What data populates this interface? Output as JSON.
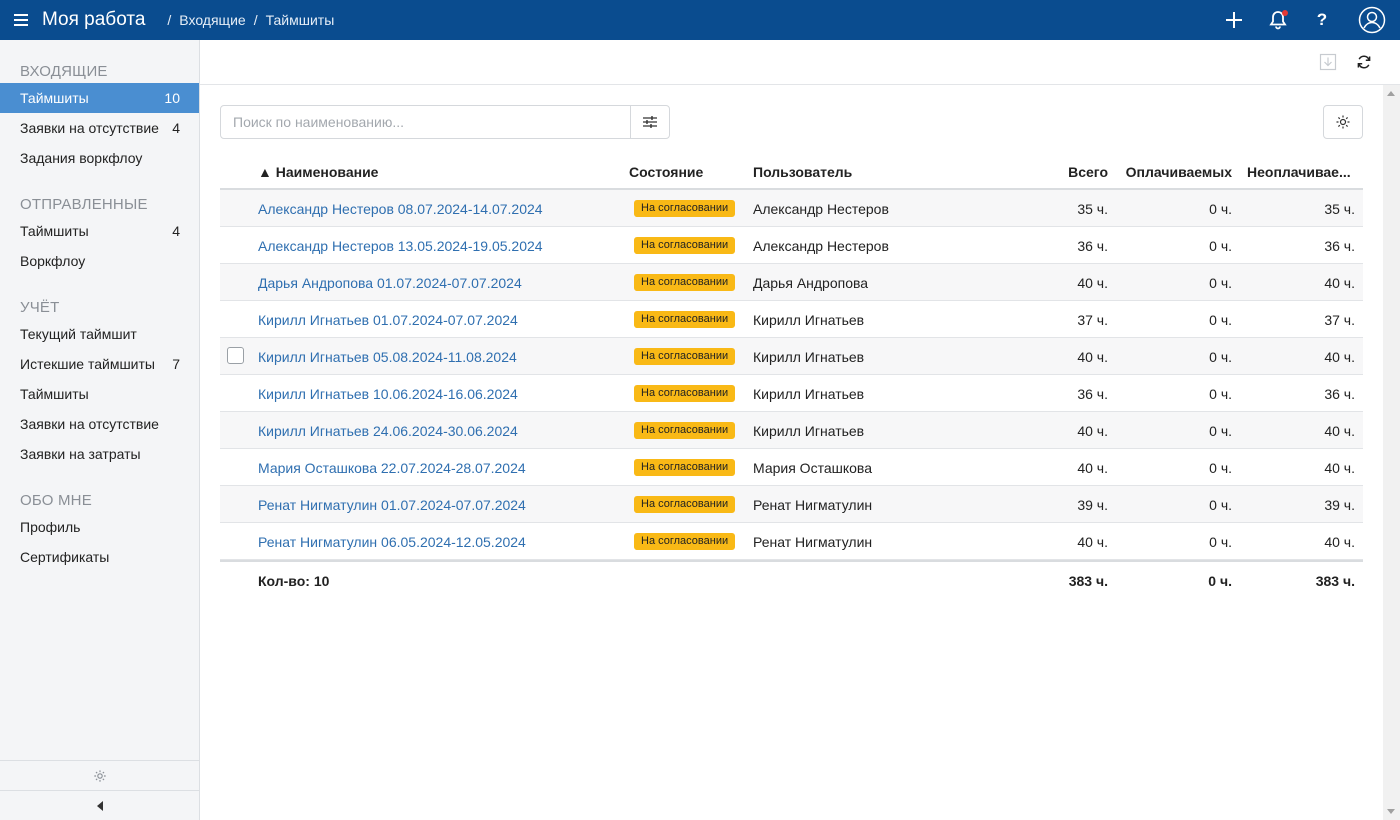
{
  "header": {
    "title": "Моя работа",
    "breadcrumbs": [
      "Входящие",
      "Таймшиты"
    ]
  },
  "sidebar": {
    "sections": [
      {
        "title": "ВХОДЯЩИЕ",
        "items": [
          {
            "label": "Таймшиты",
            "count": "10",
            "active": true
          },
          {
            "label": "Заявки на отсутствие",
            "count": "4"
          },
          {
            "label": "Задания воркфлоу",
            "count": ""
          }
        ]
      },
      {
        "title": "ОТПРАВЛЕННЫЕ",
        "items": [
          {
            "label": "Таймшиты",
            "count": "4"
          },
          {
            "label": "Воркфлоу",
            "count": ""
          }
        ]
      },
      {
        "title": "УЧЁТ",
        "items": [
          {
            "label": "Текущий таймшит",
            "count": ""
          },
          {
            "label": "Истекшие таймшиты",
            "count": "7"
          },
          {
            "label": "Таймшиты",
            "count": ""
          },
          {
            "label": "Заявки на отсутствие",
            "count": ""
          },
          {
            "label": "Заявки на затраты",
            "count": ""
          }
        ]
      },
      {
        "title": "ОБО МНЕ",
        "items": [
          {
            "label": "Профиль",
            "count": ""
          },
          {
            "label": "Сертификаты",
            "count": ""
          }
        ]
      }
    ]
  },
  "search": {
    "placeholder": "Поиск по наименованию..."
  },
  "table": {
    "sort_indicator": "▲",
    "columns": {
      "name": "Наименование",
      "state": "Состояние",
      "user": "Пользователь",
      "total": "Всего",
      "billable": "Оплачиваемых",
      "nonbillable": "Неоплачивае..."
    },
    "rows": [
      {
        "name": "Александр Нестеров 08.07.2024-14.07.2024",
        "state": "На согласовании",
        "user": "Александр Нестеров",
        "total": "35 ч.",
        "billable": "0 ч.",
        "nonbillable": "35 ч."
      },
      {
        "name": "Александр Нестеров 13.05.2024-19.05.2024",
        "state": "На согласовании",
        "user": "Александр Нестеров",
        "total": "36 ч.",
        "billable": "0 ч.",
        "nonbillable": "36 ч."
      },
      {
        "name": "Дарья Андропова 01.07.2024-07.07.2024",
        "state": "На согласовании",
        "user": "Дарья Андропова",
        "total": "40 ч.",
        "billable": "0 ч.",
        "nonbillable": "40 ч."
      },
      {
        "name": "Кирилл Игнатьев 01.07.2024-07.07.2024",
        "state": "На согласовании",
        "user": "Кирилл Игнатьев",
        "total": "37 ч.",
        "billable": "0 ч.",
        "nonbillable": "37 ч."
      },
      {
        "name": "Кирилл Игнатьев 05.08.2024-11.08.2024",
        "state": "На согласовании",
        "user": "Кирилл Игнатьев",
        "total": "40 ч.",
        "billable": "0 ч.",
        "nonbillable": "40 ч.",
        "checkbox": true
      },
      {
        "name": "Кирилл Игнатьев 10.06.2024-16.06.2024",
        "state": "На согласовании",
        "user": "Кирилл Игнатьев",
        "total": "36 ч.",
        "billable": "0 ч.",
        "nonbillable": "36 ч."
      },
      {
        "name": "Кирилл Игнатьев 24.06.2024-30.06.2024",
        "state": "На согласовании",
        "user": "Кирилл Игнатьев",
        "total": "40 ч.",
        "billable": "0 ч.",
        "nonbillable": "40 ч."
      },
      {
        "name": "Мария Осташкова 22.07.2024-28.07.2024",
        "state": "На согласовании",
        "user": "Мария Осташкова",
        "total": "40 ч.",
        "billable": "0 ч.",
        "nonbillable": "40 ч."
      },
      {
        "name": "Ренат Нигматулин 01.07.2024-07.07.2024",
        "state": "На согласовании",
        "user": "Ренат Нигматулин",
        "total": "39 ч.",
        "billable": "0 ч.",
        "nonbillable": "39 ч."
      },
      {
        "name": "Ренат Нигматулин 06.05.2024-12.05.2024",
        "state": "На согласовании",
        "user": "Ренат Нигматулин",
        "total": "40 ч.",
        "billable": "0 ч.",
        "nonbillable": "40 ч."
      }
    ],
    "footer": {
      "count_label": "Кол-во: 10",
      "total": "383 ч.",
      "billable": "0 ч.",
      "nonbillable": "383 ч."
    }
  },
  "colors": {
    "topbar": "#0a4c8f",
    "active": "#4a8ed1",
    "link": "#2f6fb0",
    "badge": "#f9b916"
  },
  "icons": [
    "menu-icon",
    "plus-icon",
    "bell-icon",
    "help-icon",
    "user-icon",
    "export-icon",
    "refresh-icon",
    "filter-icon",
    "gear-icon",
    "collapse-left-icon"
  ]
}
